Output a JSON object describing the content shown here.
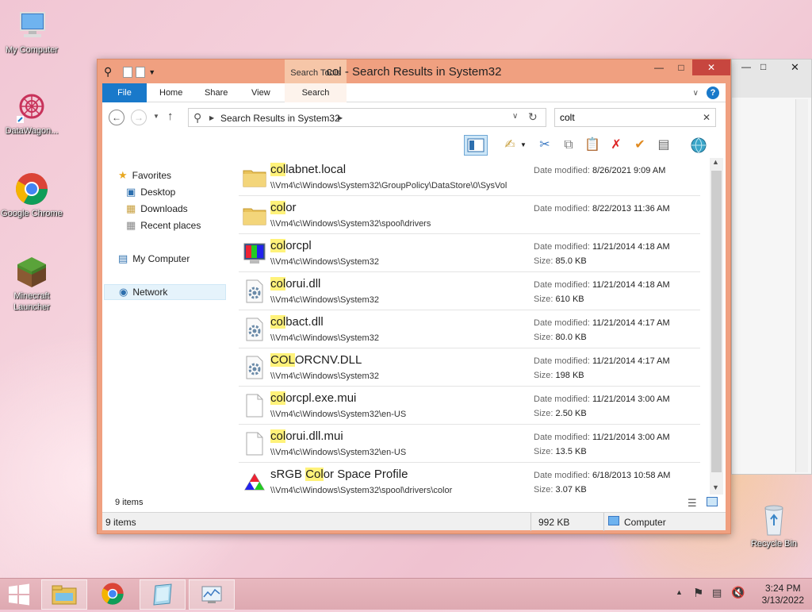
{
  "desktop": {
    "icons": [
      {
        "label": "My Computer"
      },
      {
        "label": "DataWagon..."
      },
      {
        "label": "Google Chrome"
      },
      {
        "label": "Minecraft Launcher"
      },
      {
        "label": "Recycle Bin"
      }
    ]
  },
  "window": {
    "title": "col - Search Results in System32",
    "contextual_tab_group": "Search Tools",
    "ribbon_tabs": [
      "File",
      "Home",
      "Share",
      "View",
      "Search"
    ],
    "address": {
      "segment": "Search Results in System32"
    },
    "search": {
      "value": "colt"
    },
    "nav": {
      "favorites": "Favorites",
      "desktop": "Desktop",
      "downloads": "Downloads",
      "recent": "Recent places",
      "computer": "My Computer",
      "network": "Network"
    },
    "results": [
      {
        "match": "col",
        "rest": "labnet.local",
        "path": "\\\\Vm4\\c\\Windows\\System32\\GroupPolicy\\DataStore\\0\\SysVol",
        "modified_label": "Date modified:",
        "modified": "8/26/2021 9:09 AM",
        "size_label": "",
        "size": "",
        "icon": "folder-icon"
      },
      {
        "match": "col",
        "rest": "or",
        "path": "\\\\Vm4\\c\\Windows\\System32\\spool\\drivers",
        "modified_label": "Date modified:",
        "modified": "8/22/2013 11:36 AM",
        "size_label": "",
        "size": "",
        "icon": "folder-icon"
      },
      {
        "match": "col",
        "rest": "orcpl",
        "path": "\\\\Vm4\\c\\Windows\\System32",
        "modified_label": "Date modified:",
        "modified": "11/21/2014 4:18 AM",
        "size_label": "Size:",
        "size": "85.0 KB",
        "icon": "color-management-icon"
      },
      {
        "match": "col",
        "rest": "orui.dll",
        "path": "\\\\Vm4\\c\\Windows\\System32",
        "modified_label": "Date modified:",
        "modified": "11/21/2014 4:18 AM",
        "size_label": "Size:",
        "size": "610 KB",
        "icon": "dll-gear-icon"
      },
      {
        "match": "col",
        "rest": "bact.dll",
        "path": "\\\\Vm4\\c\\Windows\\System32",
        "modified_label": "Date modified:",
        "modified": "11/21/2014 4:17 AM",
        "size_label": "Size:",
        "size": "80.0 KB",
        "icon": "dll-gear-icon"
      },
      {
        "match": "COL",
        "rest": "ORCNV.DLL",
        "path": "\\\\Vm4\\c\\Windows\\System32",
        "modified_label": "Date modified:",
        "modified": "11/21/2014 4:17 AM",
        "size_label": "Size:",
        "size": "198 KB",
        "icon": "dll-gear-icon"
      },
      {
        "match": "col",
        "rest": "orcpl.exe.mui",
        "path": "\\\\Vm4\\c\\Windows\\System32\\en-US",
        "modified_label": "Date modified:",
        "modified": "11/21/2014 3:00 AM",
        "size_label": "Size:",
        "size": "2.50 KB",
        "icon": "blank-file-icon"
      },
      {
        "match": "col",
        "rest": "orui.dll.mui",
        "path": "\\\\Vm4\\c\\Windows\\System32\\en-US",
        "modified_label": "Date modified:",
        "modified": "11/21/2014 3:00 AM",
        "size_label": "Size:",
        "size": "13.5 KB",
        "icon": "blank-file-icon"
      },
      {
        "prefix": "sRGB ",
        "match": "Col",
        "rest": "or Space Profile",
        "path": "\\\\Vm4\\c\\Windows\\System32\\spool\\drivers\\color",
        "modified_label": "Date modified:",
        "modified": "6/18/2013 10:58 AM",
        "size_label": "Size:",
        "size": "3.07 KB",
        "icon": "color-profile-icon"
      }
    ],
    "item_count": "9 items",
    "status": {
      "items": "9 items",
      "size": "992 KB",
      "location": "Computer"
    }
  },
  "taskbar": {
    "time": "3:24 PM",
    "date": "3/13/2022"
  }
}
